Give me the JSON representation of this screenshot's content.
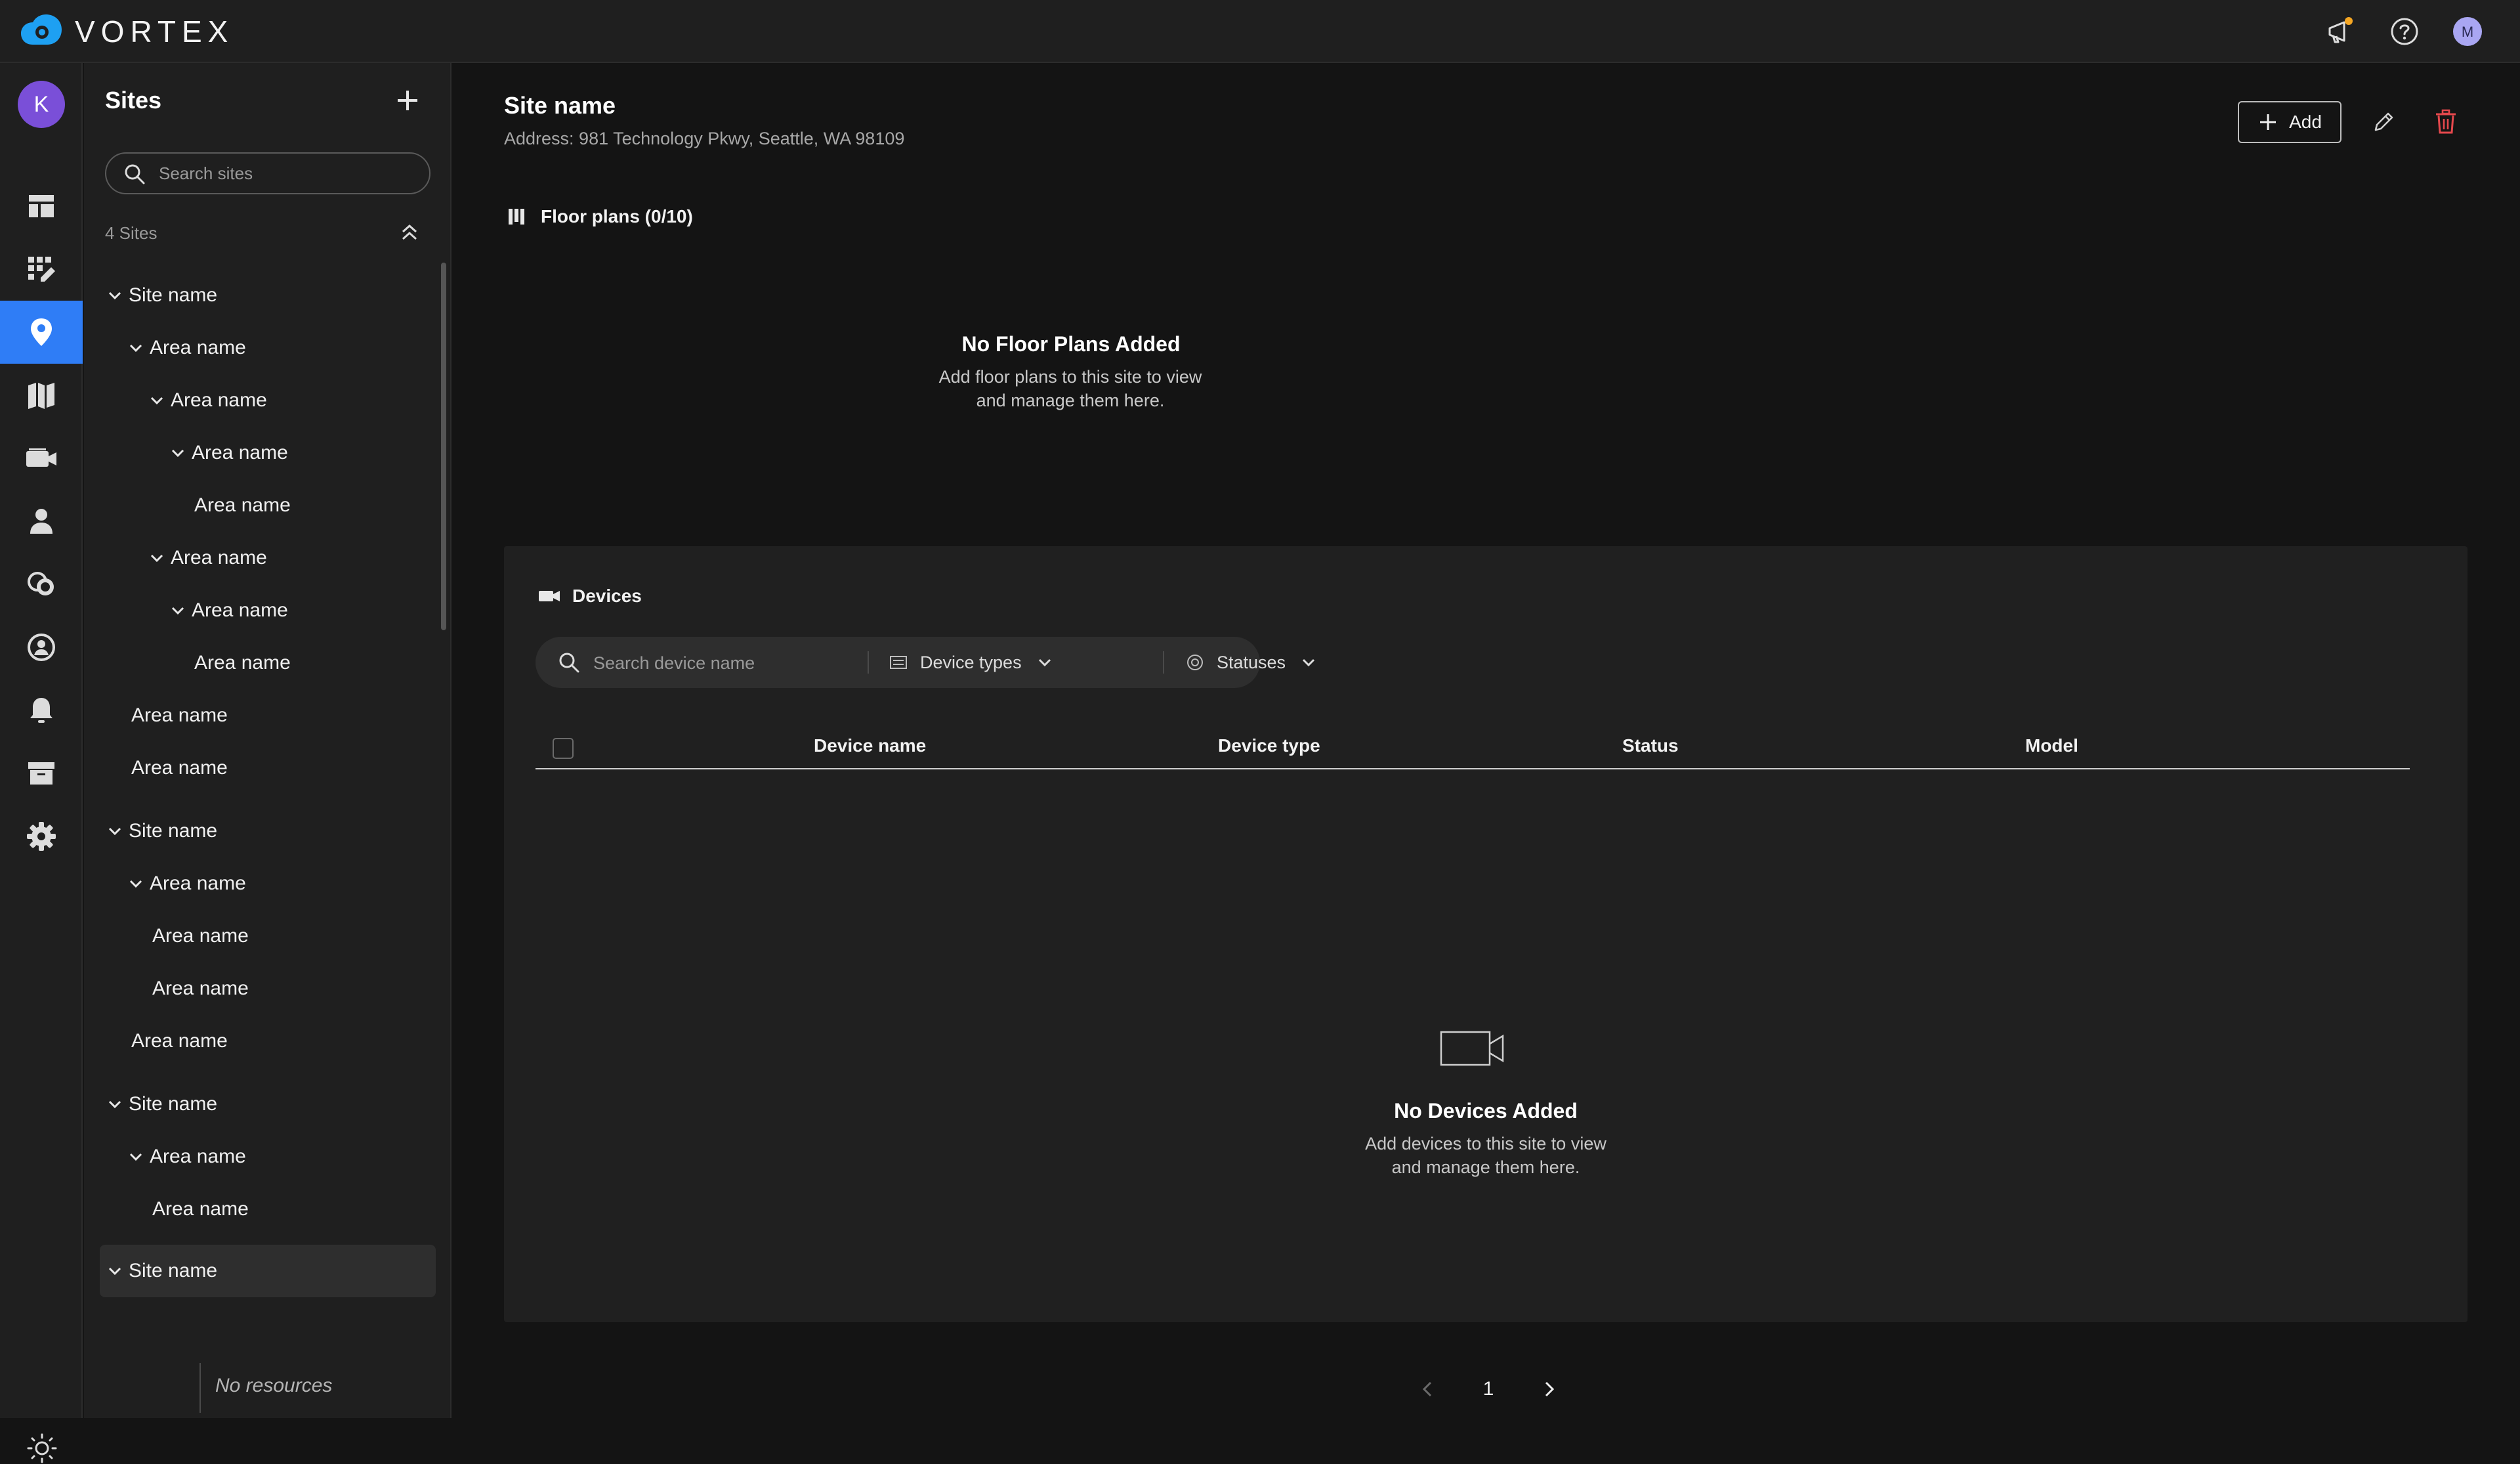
{
  "brand": {
    "name": "VORTEX"
  },
  "topbar": {
    "icons": [
      "announcement-icon",
      "help-icon",
      "avatar"
    ],
    "avatar_initial": "M",
    "notification_dot_color": "#f5a623"
  },
  "rail": {
    "avatar_initial": "K",
    "active_item": "sites",
    "items": [
      "dashboard",
      "widgets",
      "sites",
      "maps",
      "devices",
      "users",
      "integrations",
      "account",
      "alerts",
      "archive",
      "settings"
    ]
  },
  "sites_panel": {
    "title": "Sites",
    "search_placeholder": "Search sites",
    "count": "4 Sites",
    "tree": [
      {
        "label": "Site name",
        "expanded": true
      },
      {
        "label": "Area name",
        "expanded": true
      },
      {
        "label": "Area name",
        "expanded": true
      },
      {
        "label": "Area name",
        "expanded": true
      },
      {
        "label": "Area name"
      },
      {
        "label": "Area name",
        "expanded": true
      },
      {
        "label": "Area name",
        "expanded": true
      },
      {
        "label": "Area name"
      },
      {
        "label": "Area name"
      },
      {
        "label": "Area name"
      },
      {
        "label": "Site name",
        "expanded": true
      },
      {
        "label": "Area name",
        "expanded": true
      },
      {
        "label": "Area name"
      },
      {
        "label": "Area name"
      },
      {
        "label": "Area name"
      },
      {
        "label": "Site name",
        "expanded": true
      },
      {
        "label": "Area name",
        "expanded": true
      },
      {
        "label": "Area name"
      },
      {
        "label": "Site name",
        "expanded": true,
        "selected": true
      }
    ],
    "no_resources": "No resources"
  },
  "site": {
    "title": "Site name",
    "address": "Address: 981 Technology Pkwy, Seattle, WA 98109",
    "add_label": "Add"
  },
  "floor_plans": {
    "header": "Floor plans (0/10)",
    "empty_title": "No Floor Plans Added",
    "empty_text": "Add floor plans to this site to view and manage them here."
  },
  "devices": {
    "header": "Devices",
    "search_placeholder": "Search device name",
    "filter_types": "Device types",
    "filter_statuses": "Statuses",
    "columns": [
      "Device name",
      "Device type",
      "Status",
      "Model"
    ],
    "empty_title": "No Devices Added",
    "empty_text": "Add devices to this site to view and manage them here."
  },
  "pagination": {
    "current_page": "1"
  },
  "colors": {
    "accent": "#2f7df6",
    "danger": "#e5484d",
    "background": "#141414",
    "panel": "#1f1f1f",
    "card": "#202020"
  }
}
